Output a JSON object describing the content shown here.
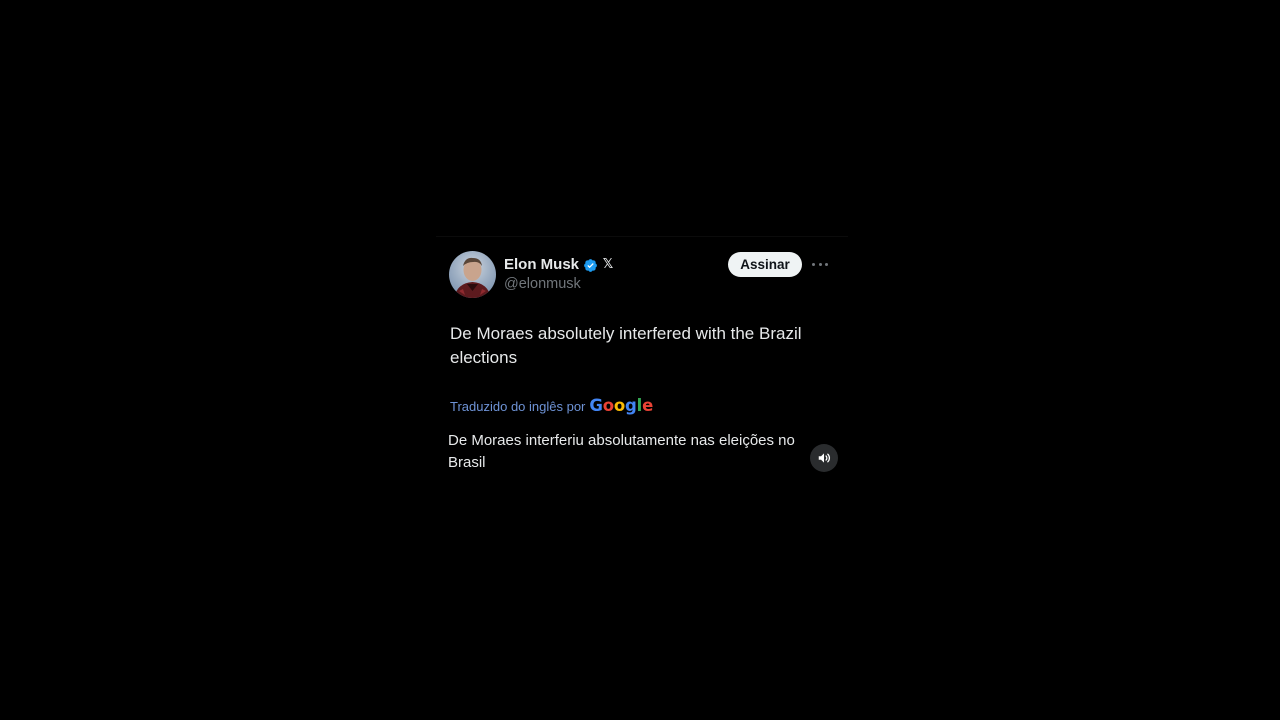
{
  "tweet": {
    "author": {
      "name": "Elon Musk",
      "handle": "@elonmusk",
      "verified_icon": "verified-badge-icon",
      "affiliate_icon": "x-logo-icon",
      "affiliate_glyph": "𝕏"
    },
    "subscribe_label": "Assinar",
    "more_icon": "more-horizontal-icon",
    "text": "De Moraes absolutely interfered with the Brazil elections",
    "translation": {
      "label": "Traduzido do inglês por",
      "provider_letters": [
        "G",
        "o",
        "o",
        "g",
        "l",
        "e"
      ],
      "text": "De Moraes interferiu absolutamente nas eleições no Brasil",
      "audio_icon": "speaker-icon"
    }
  },
  "colors": {
    "background": "#000000",
    "text_primary": "#e7e9ea",
    "text_secondary": "#71767b",
    "verified_blue": "#1d9bf0",
    "translation_link": "#6e93d6",
    "google_blue": "#4285f4",
    "google_red": "#ea4335",
    "google_yellow": "#fbbc05",
    "google_green": "#34a853"
  }
}
